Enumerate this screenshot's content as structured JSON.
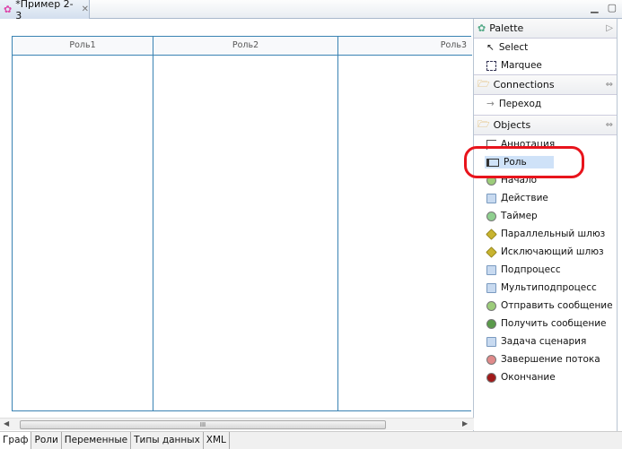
{
  "editor_tab": {
    "title": "*Пример 2-3"
  },
  "lanes": [
    {
      "label": "Роль1"
    },
    {
      "label": "Роль2"
    },
    {
      "label": "Роль3"
    }
  ],
  "scrollbar": {
    "thumb_grip": "III"
  },
  "palette": {
    "title": "Palette",
    "tools": [
      {
        "label": "Select",
        "icon": "arrow-cursor-icon"
      },
      {
        "label": "Marquee",
        "icon": "marquee-icon"
      }
    ],
    "connections": {
      "title": "Connections",
      "items": [
        {
          "label": "Переход",
          "icon": "arrow-right-icon"
        }
      ]
    },
    "objects": {
      "title": "Objects",
      "items": [
        {
          "label": "Аннотация",
          "icon": "annotation-icon",
          "color": "#555555"
        },
        {
          "label": "Роль",
          "icon": "lane-icon",
          "color": "#333333",
          "selected": true
        },
        {
          "label": "Начало",
          "icon": "start-event-icon",
          "color": "#9ccc7a"
        },
        {
          "label": "Действие",
          "icon": "task-icon",
          "color": "#c8daf0"
        },
        {
          "label": "Таймер",
          "icon": "timer-icon",
          "color": "#8fcf8f"
        },
        {
          "label": "Параллельный шлюз",
          "icon": "parallel-gateway-icon",
          "color": "#c8b430"
        },
        {
          "label": "Исключающий шлюз",
          "icon": "exclusive-gateway-icon",
          "color": "#c8b430"
        },
        {
          "label": "Подпроцесс",
          "icon": "subprocess-icon",
          "color": "#c8daf0"
        },
        {
          "label": "Мультиподпроцесс",
          "icon": "multi-subprocess-icon",
          "color": "#c8daf0"
        },
        {
          "label": "Отправить сообщение",
          "icon": "send-message-icon",
          "color": "#9ccc7a"
        },
        {
          "label": "Получить сообщение",
          "icon": "receive-message-icon",
          "color": "#5a9a4a"
        },
        {
          "label": "Задача сценария",
          "icon": "script-task-icon",
          "color": "#c8daf0"
        },
        {
          "label": "Завершение потока",
          "icon": "terminate-flow-icon",
          "color": "#e08a8a"
        },
        {
          "label": "Окончание",
          "icon": "end-event-icon",
          "color": "#a01a1a"
        }
      ]
    }
  },
  "bottom_tabs": [
    {
      "label": "Граф",
      "active": true
    },
    {
      "label": "Роли"
    },
    {
      "label": "Переменные"
    },
    {
      "label": "Типы данных"
    },
    {
      "label": "XML"
    }
  ],
  "highlight_color": "#e8141c"
}
